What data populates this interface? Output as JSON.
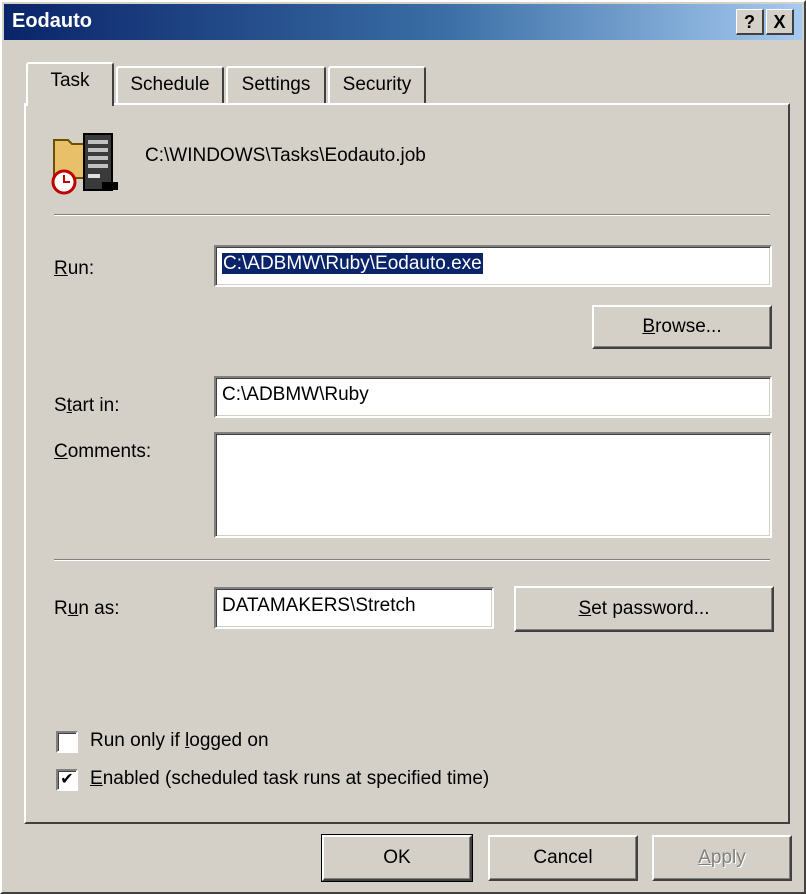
{
  "window": {
    "title": "Eodauto",
    "help_button": "?",
    "close_button": "X"
  },
  "tabs": [
    {
      "label": "Task",
      "active": true
    },
    {
      "label": "Schedule",
      "active": false
    },
    {
      "label": "Settings",
      "active": false
    },
    {
      "label": "Security",
      "active": false
    }
  ],
  "task": {
    "job_icon": "scheduled-task-icon",
    "job_path": "C:\\WINDOWS\\Tasks\\Eodauto.job",
    "run": {
      "label_key": "R",
      "label_rest": "un:",
      "value": "C:\\ADBMW\\Ruby\\Eodauto.exe"
    },
    "browse": {
      "key": "B",
      "rest": "rowse..."
    },
    "start_in": {
      "label_pre": "S",
      "label_key": "t",
      "label_rest": "art in:",
      "value": "C:\\ADBMW\\Ruby"
    },
    "comments": {
      "label_key": "C",
      "label_rest": "omments:",
      "value": ""
    },
    "run_as": {
      "label_pre": "R",
      "label_key": "u",
      "label_rest": "n as:",
      "value": "DATAMAKERS\\Stretch"
    },
    "set_password": {
      "key": "S",
      "rest": "et password..."
    },
    "run_only_logged_on": {
      "pre": "Run only if ",
      "key": "l",
      "rest": "ogged on",
      "checked": false
    },
    "enabled": {
      "key": "E",
      "rest": "nabled (scheduled task runs at specified time)",
      "checked": true,
      "check_glyph": "✔"
    }
  },
  "buttons": {
    "ok": "OK",
    "cancel": "Cancel",
    "apply_key": "A",
    "apply_rest": "pply"
  },
  "colors": {
    "face": "#d4d0c8",
    "title_start": "#0a246a",
    "title_end": "#a6caf0",
    "selection": "#0a246a"
  }
}
